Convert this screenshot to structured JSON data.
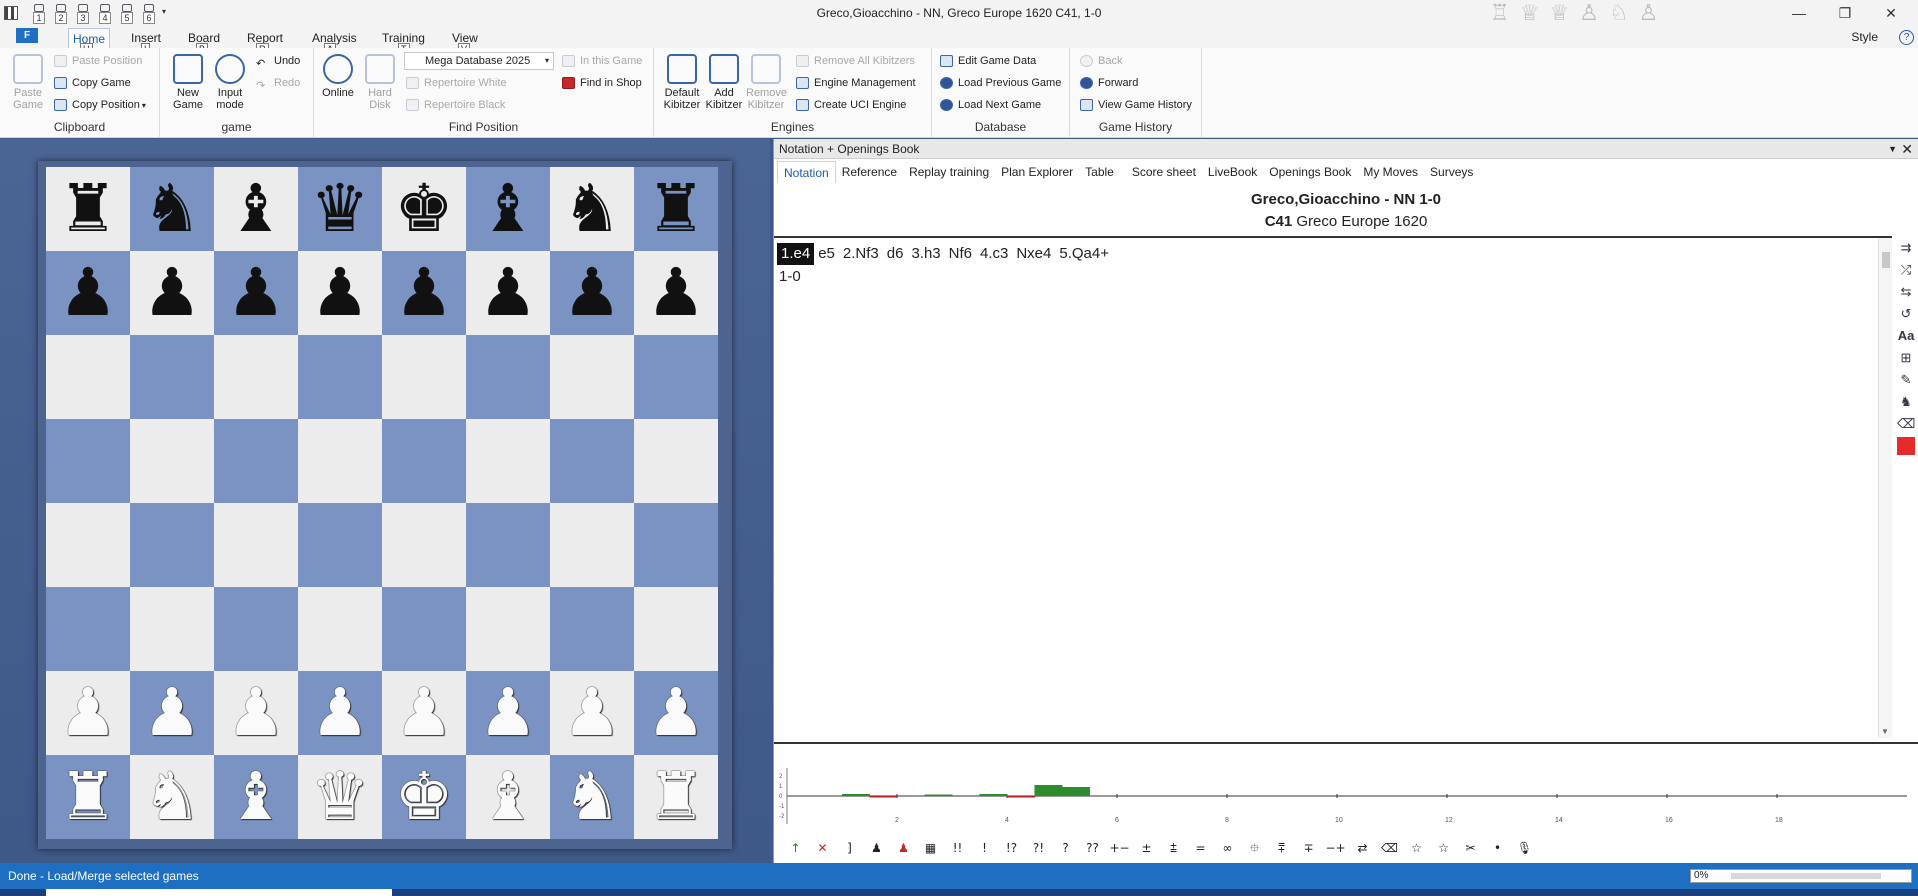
{
  "window": {
    "title": "Greco,Gioacchino - NN, Greco Europe 1620  C41, 1-0",
    "quick_access": [
      "1",
      "2",
      "3",
      "4",
      "5",
      "6"
    ],
    "controls": {
      "minimize": "—",
      "maximize": "❐",
      "close": "✕"
    }
  },
  "ribbon_tabs": {
    "file": "F",
    "tabs": [
      {
        "label": "Home",
        "key": "H"
      },
      {
        "label": "Insert",
        "key": "I"
      },
      {
        "label": "Board",
        "key": "B"
      },
      {
        "label": "Report",
        "key": "R"
      },
      {
        "label": "Analysis",
        "key": "A"
      },
      {
        "label": "Training",
        "key": "T"
      },
      {
        "label": "View",
        "key": "V"
      }
    ],
    "style": "Style",
    "help": "?"
  },
  "ribbon": {
    "clipboard": {
      "label": "Clipboard",
      "paste_game": "Paste Game",
      "paste_position": "Paste Position",
      "copy_game": "Copy Game",
      "copy_position": "Copy Position"
    },
    "game": {
      "label": "game",
      "new_game": "New Game",
      "input_mode": "Input mode",
      "undo": "Undo",
      "redo": "Redo"
    },
    "find_position": {
      "label": "Find Position",
      "online": "Online",
      "hard_disk": "Hard Disk",
      "database": "Mega Database 2025",
      "in_this_game": "In this Game",
      "repertoire_white": "Repertoire White",
      "repertoire_black": "Repertoire Black",
      "find_in_shop": "Find in Shop"
    },
    "engines": {
      "label": "Engines",
      "default_kibitzer": "Default Kibitzer",
      "add_kibitzer": "Add Kibitzer",
      "remove_kibitzer": "Remove Kibitzer",
      "remove_all": "Remove All Kibitzers",
      "engine_management": "Engine Management",
      "create_uci": "Create UCI Engine"
    },
    "database": {
      "label": "Database",
      "edit_game_data": "Edit Game Data",
      "load_previous": "Load Previous Game",
      "load_next": "Load Next Game"
    },
    "game_history": {
      "label": "Game History",
      "back": "Back",
      "forward": "Forward",
      "view_history": "View Game History"
    }
  },
  "board": {
    "ranks": [
      [
        "bR",
        "bN",
        "bB",
        "bQ",
        "bK",
        "bB",
        "bN",
        "bR"
      ],
      [
        "bP",
        "bP",
        "bP",
        "bP",
        "bP",
        "bP",
        "bP",
        "bP"
      ],
      [
        "",
        "",
        "",
        "",
        "",
        "",
        "",
        ""
      ],
      [
        "",
        "",
        "",
        "",
        "",
        "",
        "",
        ""
      ],
      [
        "",
        "",
        "",
        "",
        "",
        "",
        "",
        ""
      ],
      [
        "",
        "",
        "",
        "",
        "",
        "",
        "",
        ""
      ],
      [
        "wP",
        "wP",
        "wP",
        "wP",
        "wP",
        "wP",
        "wP",
        "wP"
      ],
      [
        "wR",
        "wN",
        "wB",
        "wQ",
        "wK",
        "wB",
        "wN",
        "wR"
      ]
    ],
    "light_color": "#ececec",
    "dark_color": "#7b93c2"
  },
  "notation_panel": {
    "title": "Notation + Openings Book",
    "tabs": [
      "Notation",
      "Reference",
      "Replay training",
      "Plan Explorer",
      "Table",
      "Score sheet",
      "LiveBook",
      "Openings Book",
      "My Moves",
      "Surveys"
    ],
    "header_line1": "Greco,Gioacchino - NN  1-0",
    "eco": "C41",
    "header_line2": "Greco Europe 1620",
    "moves": [
      "1.e4",
      "e5",
      "2.Nf3",
      "d6",
      "3.h3",
      "Nf6",
      "4.c3",
      "Nxe4",
      "5.Qa4+"
    ],
    "current_move": 0,
    "result": "1-0"
  },
  "eval_graph": {
    "x_labels": [
      "2",
      "4",
      "6",
      "8",
      "10",
      "12",
      "14",
      "16",
      "18"
    ],
    "y_labels": [
      "2",
      "1",
      "0",
      "-1",
      "-2"
    ],
    "bars": [
      {
        "move": 1,
        "value": 0.2
      },
      {
        "move": 1.5,
        "value": -0.1
      },
      {
        "move": 2.5,
        "value": 0.15
      },
      {
        "move": 3.5,
        "value": 0.2
      },
      {
        "move": 4,
        "value": -0.1
      },
      {
        "move": 4.5,
        "value": 1.1
      },
      {
        "move": 5,
        "value": 0.9
      }
    ]
  },
  "symbols": [
    "↑",
    "✕",
    "]",
    "♟",
    "♟",
    "▦",
    "!!",
    "!",
    "!?",
    "?!",
    "?",
    "??",
    "+−",
    "±",
    "⩲",
    "=",
    "∞",
    "⯐",
    "⩱",
    "∓",
    "−+",
    "⇄",
    "⌫",
    "☆",
    "☆",
    "✂",
    "•",
    "🎙"
  ],
  "status": {
    "text": "Done - Load/Merge selected games",
    "progress": "0%"
  }
}
